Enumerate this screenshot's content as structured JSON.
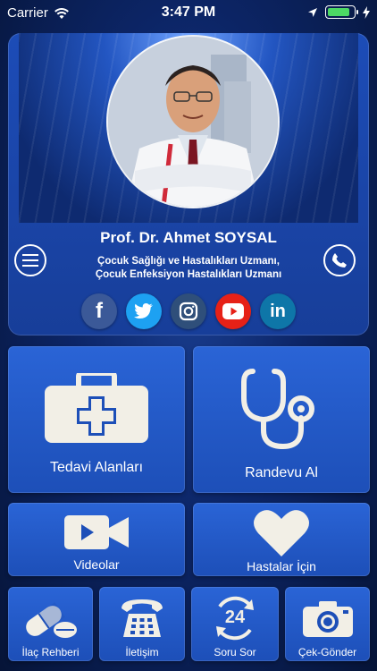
{
  "status_bar": {
    "carrier": "Carrier",
    "time": "3:47 PM"
  },
  "profile": {
    "name": "Prof. Dr. Ahmet SOYSAL",
    "title_line1": "Çocuk Sağlığı ve Hastalıkları Uzmanı,",
    "title_line2": "Çocuk Enfeksiyon Hastalıkları Uzmanı",
    "social": [
      {
        "name": "facebook",
        "glyph": "f",
        "color": "#3b5998"
      },
      {
        "name": "twitter",
        "glyph": "t",
        "color": "#1da1f2"
      },
      {
        "name": "instagram",
        "glyph": "◎",
        "color": "#2f4f7a"
      },
      {
        "name": "youtube",
        "glyph": "▶",
        "color": "#e62117"
      },
      {
        "name": "linkedin",
        "glyph": "in",
        "color": "#0e76a8"
      }
    ]
  },
  "tiles": {
    "tedavi": "Tedavi Alanları",
    "randevu": "Randevu Al",
    "videolar": "Videolar",
    "hastalar": "Hastalar İçin",
    "ilac": "İlaç Rehberi",
    "iletisim": "İletişim",
    "soru": "Soru Sor",
    "cek": "Çek-Gönder",
    "soru_badge": "24"
  },
  "colors": {
    "accent": "#1e52be",
    "background": "#0c2566"
  }
}
